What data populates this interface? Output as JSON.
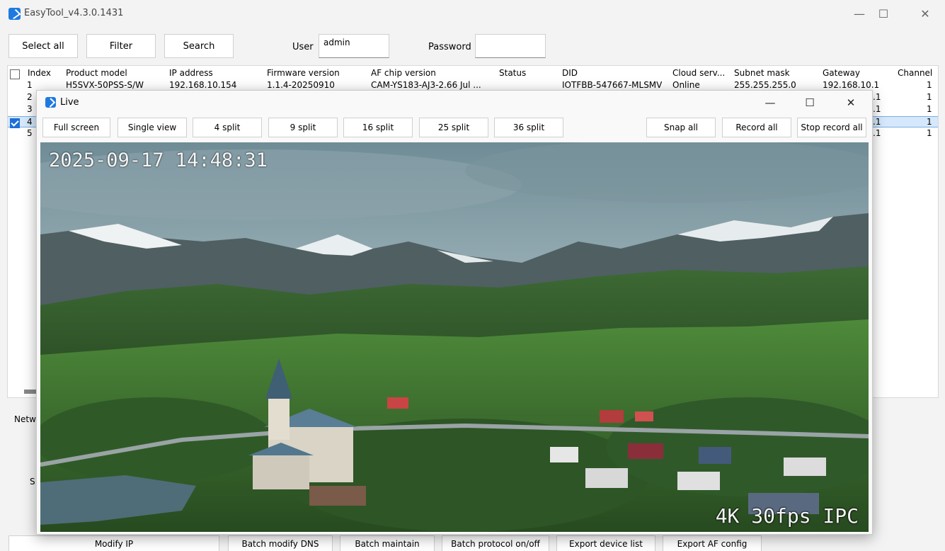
{
  "app": {
    "title": "EasyTool_v4.3.0.1431",
    "win_min": "—",
    "win_max": "☐",
    "win_close": "✕"
  },
  "toolbar": {
    "select_all": "Select all",
    "filter": "Filter",
    "search": "Search",
    "user_label": "User",
    "user_value": "admin",
    "password_label": "Password",
    "password_value": ""
  },
  "table": {
    "headers": [
      "Index",
      "Product model",
      "IP address",
      "Firmware version",
      "AF chip version",
      "Status",
      "DID",
      "Cloud serv...",
      "Subnet mask",
      "Gateway",
      "Channel"
    ],
    "rows": [
      {
        "index": "1",
        "model": "H5SVX-50PSS-S/W",
        "ip": "192.168.10.154",
        "fw": "1.1.4-20250910",
        "af": "CAM-YS183-AJ3-2.66 Jul ...",
        "status": "",
        "did": "IOTFBB-547667-MLSMV",
        "cloud": "Online",
        "mask": "255.255.255.0",
        "gateway": "192.168.10.1",
        "channel": "1",
        "checked": false,
        "selected": false
      },
      {
        "index": "2",
        "gateway": ".1",
        "channel": "1",
        "checked": false,
        "selected": false
      },
      {
        "index": "3",
        "gateway": ".1",
        "channel": "1",
        "checked": false,
        "selected": false
      },
      {
        "index": "4",
        "gateway": ".1",
        "channel": "1",
        "checked": true,
        "selected": true
      },
      {
        "index": "5",
        "gateway": ".1",
        "channel": "1",
        "checked": false,
        "selected": false
      }
    ]
  },
  "side_fragments": {
    "netw": "Netw",
    "s": "S"
  },
  "bottom_tabs": [
    "Modify IP",
    "Batch modify DNS",
    "Batch maintain",
    "Batch protocol on/off",
    "Export device list",
    "Export AF config"
  ],
  "live": {
    "title": "Live",
    "win_min": "—",
    "win_max": "☐",
    "win_close": "✕",
    "buttons": {
      "full_screen": "Full screen",
      "single_view": "Single view",
      "split4": "4 split",
      "split9": "9 split",
      "split16": "16 split",
      "split25": "25 split",
      "split36": "36 split",
      "snap_all": "Snap all",
      "record_all": "Record all",
      "stop_record_all": "Stop record all"
    },
    "osd_time": "2025-09-17 14:48:31",
    "osd_tag": "4K 30fps IPC"
  },
  "colors": {
    "accent": "#1f6fd6",
    "selected_row": "#d6e8fb"
  }
}
